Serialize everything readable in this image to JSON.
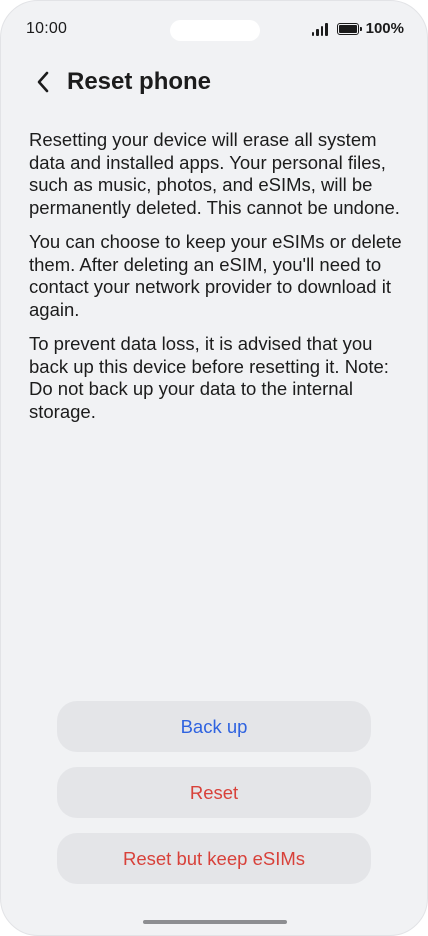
{
  "status_bar": {
    "time": "10:00",
    "battery_text": "100%",
    "icons": [
      "signal-icon",
      "battery-icon"
    ]
  },
  "header": {
    "back_icon": "chevron-left-icon",
    "title": "Reset phone"
  },
  "content": {
    "paragraphs": [
      "Resetting your device will erase all system data and installed apps. Your personal files, such as music, photos, and eSIMs, will be permanently deleted. This cannot be undone.",
      "You can choose to keep your eSIMs or delete them. After deleting an eSIM, you'll need to contact your network provider to download it again.",
      "To prevent data loss, it is advised that you back up this device before resetting it. Note: Do not back up your data to the internal storage."
    ]
  },
  "actions": {
    "back_up": {
      "label": "Back up",
      "color": "#2f63e0"
    },
    "reset": {
      "label": "Reset",
      "color": "#d8413a"
    },
    "reset_keep_esims": {
      "label": "Reset but keep eSIMs",
      "color": "#d8413a"
    }
  },
  "colors": {
    "background": "#f1f2f4",
    "button_background": "#e4e5e8",
    "text": "#1c1c1c"
  }
}
